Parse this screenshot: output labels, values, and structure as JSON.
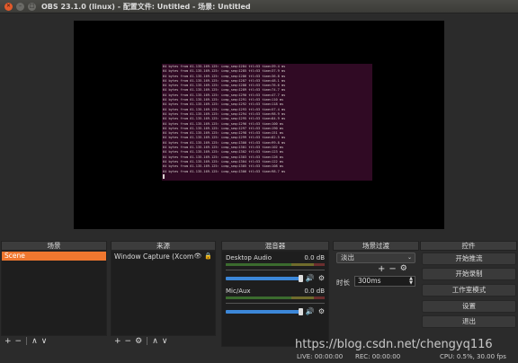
{
  "window": {
    "title": "OBS 23.1.0 (linux) - 配置文件: Untitled - 场景: Untitled",
    "close_glyph": "✕",
    "min_glyph": "–",
    "max_glyph": "□"
  },
  "terminal": {
    "lines": [
      "64 bytes from 61.135.169.125: icmp_seq=1284 ttl=53 time=39.4 ms",
      "64 bytes from 61.135.169.125: icmp_seq=1285 ttl=53 time=37.9 ms",
      "64 bytes from 61.135.169.125: icmp_seq=1286 ttl=53 time=36.8 ms",
      "64 bytes from 61.135.169.125: icmp_seq=1287 ttl=53 time=48.1 ms",
      "64 bytes from 61.135.169.125: icmp_seq=1288 ttl=53 time=76.6 ms",
      "64 bytes from 61.135.169.125: icmp_seq=1289 ttl=53 time=74.7 ms",
      "64 bytes from 61.135.169.125: icmp_seq=1290 ttl=53 time=47.7 ms",
      "64 bytes from 61.135.169.125: icmp_seq=1291 ttl=53 time=110 ms",
      "64 bytes from 61.135.169.125: icmp_seq=1292 ttl=53 time=118 ms",
      "64 bytes from 61.135.169.125: icmp_seq=1293 ttl=53 time=57.4 ms",
      "64 bytes from 61.135.169.125: icmp_seq=1294 ttl=53 time=98.9 ms",
      "64 bytes from 61.135.169.125: icmp_seq=1295 ttl=53 time=84.9 ms",
      "64 bytes from 61.135.169.125: icmp_seq=1296 ttl=53 time=100 ms",
      "64 bytes from 61.135.169.125: icmp_seq=1297 ttl=53 time=190 ms",
      "64 bytes from 61.135.169.125: icmp_seq=1298 ttl=53 time=151 ms",
      "64 bytes from 61.135.169.125: icmp_seq=1299 ttl=53 time=82.5 ms",
      "64 bytes from 61.135.169.125: icmp_seq=1300 ttl=53 time=99.8 ms",
      "64 bytes from 61.135.169.125: icmp_seq=1301 ttl=53 time=102 ms",
      "64 bytes from 61.135.169.125: icmp_seq=1302 ttl=53 time=123 ms",
      "64 bytes from 61.135.169.125: icmp_seq=1303 ttl=53 time=126 ms",
      "64 bytes from 61.135.169.125: icmp_seq=1304 ttl=53 time=122 ms",
      "64 bytes from 61.135.169.125: icmp_seq=1305 ttl=53 time=108 ms",
      "64 bytes from 61.135.169.125: icmp_seq=1306 ttl=53 time=98.7 ms"
    ]
  },
  "scenes": {
    "header": "场景",
    "items": [
      "Scene"
    ],
    "toolbar": [
      "+",
      "−",
      "|",
      "∧",
      "∨"
    ]
  },
  "sources": {
    "header": "来源",
    "items": [
      {
        "label": "Window Capture (Xcompo",
        "eye_glyph": "👁",
        "lock_glyph": "🔒"
      }
    ],
    "toolbar": [
      "+",
      "−",
      "⚙",
      "|",
      "∧",
      "∨"
    ]
  },
  "mixer": {
    "header": "混音器",
    "channels": [
      {
        "name": "Desktop Audio",
        "level": "0.0 dB",
        "volume": 1.0,
        "speaker_glyph": "🔊",
        "gear_glyph": "⚙"
      },
      {
        "name": "Mic/Aux",
        "level": "0.0 dB",
        "volume": 1.0,
        "speaker_glyph": "🔊",
        "gear_glyph": "⚙"
      }
    ]
  },
  "transitions": {
    "header": "场景过渡",
    "selected": "淡出",
    "arrow_glyph": "⌄",
    "add_glyph": "+",
    "remove_glyph": "−",
    "gear_glyph": "⚙",
    "duration_label": "时长",
    "duration_value": "300ms",
    "spin_up": "▲",
    "spin_down": "▼"
  },
  "controls": {
    "header": "控件",
    "buttons": [
      "开始推流",
      "开始录制",
      "工作室模式",
      "设置",
      "退出"
    ]
  },
  "status": {
    "live": "LIVE: 00:00:00",
    "rec": "REC: 00:00:00",
    "cpu": "CPU: 0.5%, 30.00 fps"
  },
  "watermark": "https://blog.csdn.net/chengyq116",
  "colors": {
    "accent": "#f0772f",
    "terminal_bg": "#300a24",
    "fader": "#3c87d8"
  }
}
